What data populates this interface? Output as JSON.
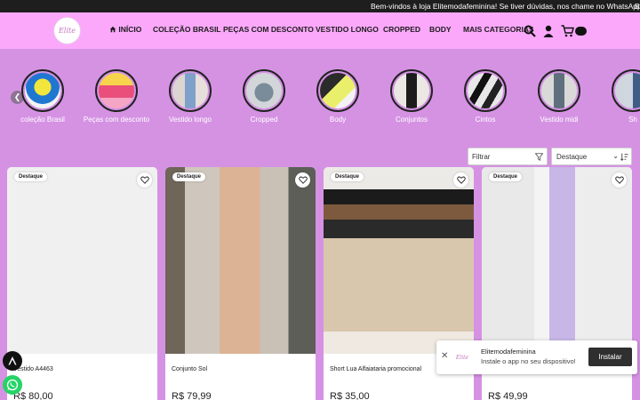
{
  "announcement": {
    "text": "Bem-vindos à loja Elitemodafeminina! Se tiver dúvidas, nos chame no WhatsApp!",
    "next": "B"
  },
  "brand": {
    "logo_text": "Elite"
  },
  "nav": [
    "INÍCIO",
    "COLEÇÃO BRASIL",
    "PEÇAS COM DESCONTO",
    "VESTIDO LONGO",
    "CROPPED",
    "BODY",
    "MAIS CATEGORIAS"
  ],
  "header_icons": [
    "search-icon",
    "user-icon",
    "cart-icon",
    "cart-count-badge"
  ],
  "categories": [
    {
      "label": "coleção Brasil"
    },
    {
      "label": "Peças com desconto"
    },
    {
      "label": "Vestido longo"
    },
    {
      "label": "Cropped"
    },
    {
      "label": "Body"
    },
    {
      "label": "Conjuntos"
    },
    {
      "label": "Cintos"
    },
    {
      "label": "Vestido midi"
    },
    {
      "label": "Sh"
    }
  ],
  "toolbar": {
    "filter_label": "Filtrar",
    "sort_label": "Destaque"
  },
  "products": [
    {
      "badge": "Destaque",
      "name": "Vestido A4463",
      "price": "R$ 80,00"
    },
    {
      "badge": "Destaque",
      "name": "Conjunto Sol",
      "price": "R$ 79,99"
    },
    {
      "badge": "Destaque",
      "name": "Short Lua Alfaiataria promocional",
      "price": "R$ 35,00"
    },
    {
      "badge": "Destaque",
      "name": "",
      "price": "R$ 49,99"
    }
  ],
  "install_prompt": {
    "logo_text": "Elite",
    "title": "Elitemodafeminina",
    "subtitle": "Instale o app no seu dispositivo!",
    "button": "Instalar"
  },
  "colors": {
    "page_bg": "#d592e3",
    "header_bg": "#fba8fb",
    "announce_bg": "#1e1e1e",
    "whatsapp": "#25d366"
  }
}
